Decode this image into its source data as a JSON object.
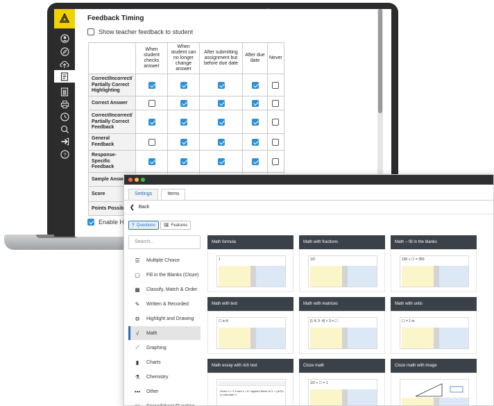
{
  "feedback_timing": {
    "title": "Feedback Timing",
    "show_teacher_feedback_label": "Show teacher feedback to student",
    "show_teacher_feedback_checked": false,
    "columns": [
      "When student checks answer",
      "When student can no longer change answer",
      "After submitting assignment but before due date",
      "After due date",
      "Never"
    ],
    "rows": [
      {
        "label": "Correct/Incorrect/ Partially Correct Highlighting",
        "checks": [
          true,
          true,
          true,
          true,
          false
        ]
      },
      {
        "label": "Correct Answer",
        "checks": [
          false,
          true,
          true,
          true,
          false
        ]
      },
      {
        "label": "Correct/Incorrect/ Partially Correct Feedback",
        "checks": [
          true,
          true,
          true,
          true,
          false
        ]
      },
      {
        "label": "General Feedback",
        "checks": [
          false,
          true,
          true,
          true,
          false
        ]
      },
      {
        "label": "Response-Specific Feedback",
        "checks": [
          true,
          true,
          true,
          true,
          false
        ]
      },
      {
        "label": "Sample Answer",
        "checks": [
          false,
          true,
          true,
          true,
          false
        ]
      },
      {
        "label": "Score",
        "checks": []
      },
      {
        "label": "Points Possible",
        "checks": []
      }
    ],
    "enable_hint_label": "Enable Hint",
    "enable_hint_checked": true
  },
  "nav_rail_icons": [
    "user-icon",
    "compass-icon",
    "cloud-icon",
    "document-icon",
    "calculator-icon",
    "print-icon",
    "clock-icon",
    "search-icon",
    "logout-icon",
    "help-icon"
  ],
  "item_window": {
    "tabs": [
      "Settings",
      "Items"
    ],
    "active_tab": "Items",
    "back_label": "Back",
    "toggle_questions": "Questions",
    "toggle_features": "Features",
    "search_placeholder": "Search...",
    "categories": [
      {
        "label": "Multiple Choice",
        "icon": "list-icon"
      },
      {
        "label": "Fill in the Blanks (Cloze)",
        "icon": "blank-box-icon"
      },
      {
        "label": "Classify, Match & Order",
        "icon": "grid-icon"
      },
      {
        "label": "Written & Recorded",
        "icon": "pencil-icon"
      },
      {
        "label": "Highlight and Drawing",
        "icon": "gear-icon"
      },
      {
        "label": "Math",
        "icon": "sqrt-icon"
      },
      {
        "label": "Graphing",
        "icon": "line-graph-icon"
      },
      {
        "label": "Charts",
        "icon": "bar-chart-icon"
      },
      {
        "label": "Chemistry",
        "icon": "flask-icon"
      },
      {
        "label": "Other",
        "icon": "more-icon"
      },
      {
        "label": "Spreadsheet Question",
        "icon": "sheet-icon"
      }
    ],
    "active_category": "Math",
    "cards": [
      {
        "title": "Math formula",
        "preview": "1"
      },
      {
        "title": "Math with fractions",
        "preview": "1/2"
      },
      {
        "title": "Math – fill in the blanks",
        "preview": "100 + ☐ = 350"
      },
      {
        "title": "Math with text",
        "preview": "☐ in ft"
      },
      {
        "title": "Math with matrices",
        "preview": "[1 4; 3 -4] × 3 = ☐"
      },
      {
        "title": "Math with units",
        "preview": "☐ = 1 m"
      },
      {
        "title": "Math essay with rich text",
        "preview": "Given x = 2.5 and k = 6 I applied these to V = (πr²)h to calculate V"
      },
      {
        "title": "Cloze math",
        "preview": "1/2 + ☐ = 1"
      },
      {
        "title": "Cloze math with image",
        "preview": ""
      }
    ],
    "colors": {
      "accent": "#2a6db0",
      "card_header": "#3b4148",
      "window_bar": "#2f2f31"
    }
  },
  "window_dots": {
    "red": "#ff5f57",
    "yellow": "#febc2e",
    "green": "#28c840"
  }
}
